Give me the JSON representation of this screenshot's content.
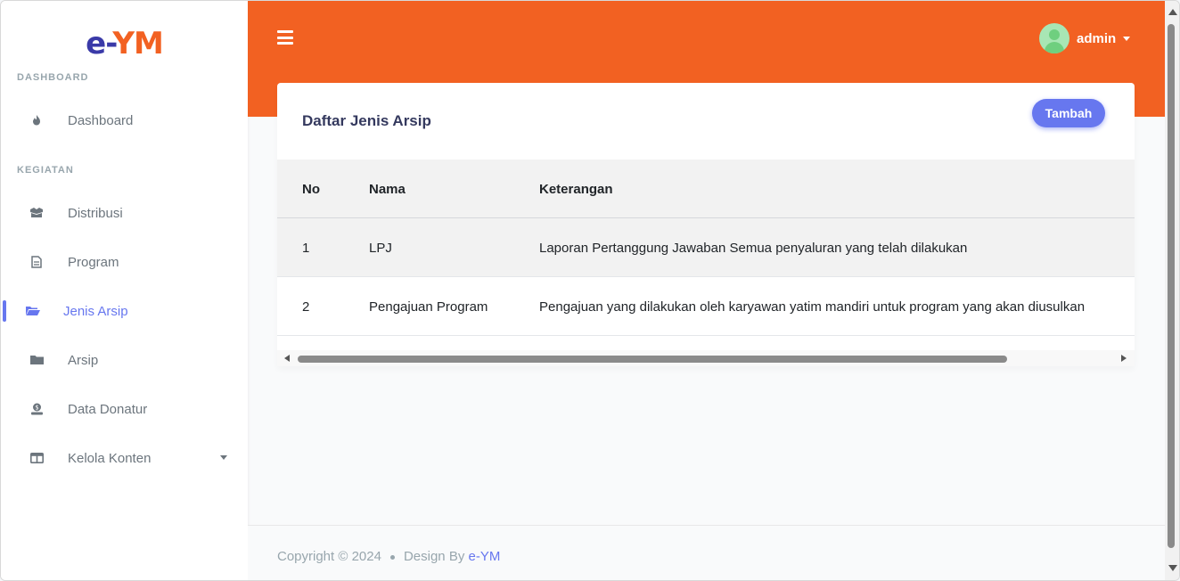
{
  "brand": {
    "part1": "e-",
    "part2": "YM"
  },
  "sidebar": {
    "sections": [
      {
        "label": "DASHBOARD"
      },
      {
        "label": "KEGIATAN"
      }
    ],
    "items": [
      {
        "label": "Dashboard",
        "icon": "fire-icon"
      },
      {
        "label": "Distribusi",
        "icon": "box-icon"
      },
      {
        "label": "Program",
        "icon": "document-icon"
      },
      {
        "label": "Jenis Arsip",
        "icon": "folder-open-icon",
        "active": true
      },
      {
        "label": "Arsip",
        "icon": "folder-icon"
      },
      {
        "label": "Data Donatur",
        "icon": "donate-icon"
      },
      {
        "label": "Kelola Konten",
        "icon": "columns-icon",
        "has_dropdown": true
      }
    ]
  },
  "header": {
    "user_name": "admin"
  },
  "card": {
    "title": "Daftar Jenis Arsip",
    "add_button": "Tambah",
    "table": {
      "columns": [
        "No",
        "Nama",
        "Keterangan"
      ],
      "rows": [
        [
          "1",
          "LPJ",
          "Laporan Pertanggung Jawaban Semua penyaluran yang telah dilakukan"
        ],
        [
          "2",
          "Pengajuan Program",
          "Pengajuan yang dilakukan oleh karyawan yatim mandiri untuk program yang akan diusulkan"
        ]
      ]
    }
  },
  "footer": {
    "copyright": "Copyright © 2024",
    "design_by": "Design By",
    "brand_link": "e-YM"
  },
  "colors": {
    "accent_orange": "#f26122",
    "primary": "#6777ef",
    "brand_blue": "#3a3aa8"
  }
}
